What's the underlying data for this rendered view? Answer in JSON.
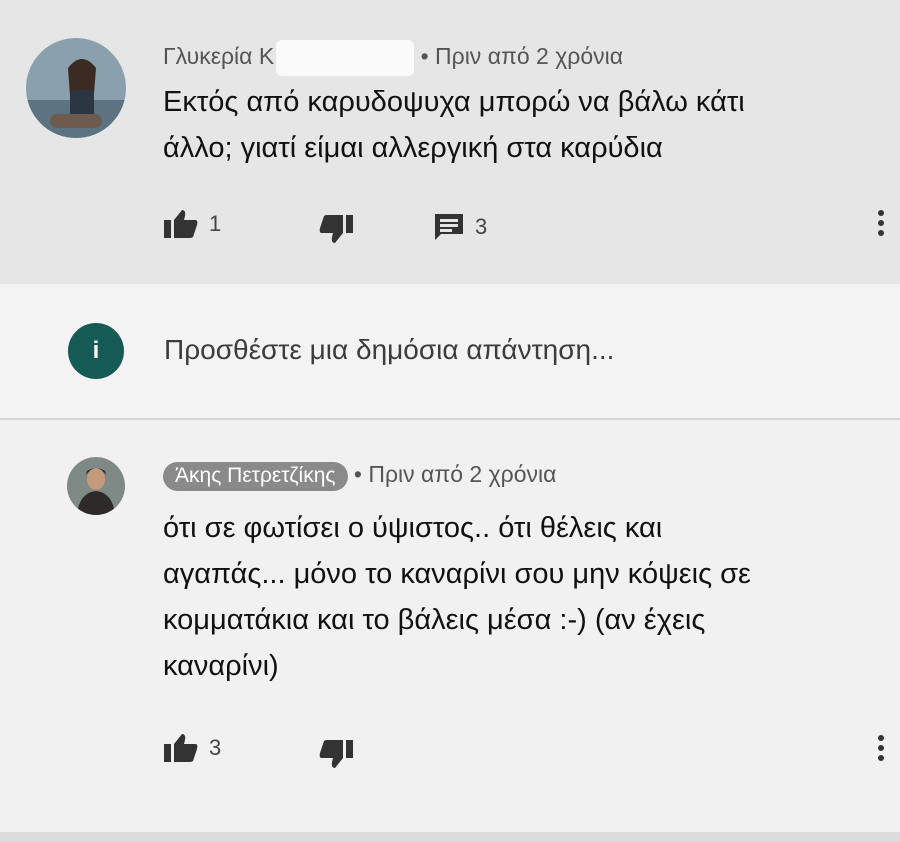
{
  "comments": [
    {
      "author": "Γλυκερία Κ",
      "time": "• Πριν από 2 χρόνια",
      "text_lines": [
        "Εκτός από καρυδοψυχα μπορώ να βάλω κάτι",
        "άλλο; γιατί είμαι αλλεργική στα καρύδια"
      ],
      "likes": "1",
      "replies": "3"
    },
    {
      "author": "Άκης Πετρετζίκης",
      "time": "• Πριν από 2 χρόνια",
      "text_lines": [
        "ότι σε φωτίσει ο ύψιστος.. ότι θέλεις και",
        "αγαπάς... μόνο το καναρίνι σου μην κόψεις σε",
        "κομματάκια και το βάλεις μέσα :-) (αν έχεις",
        "καναρίνι)"
      ],
      "likes": "3"
    }
  ],
  "reply_box": {
    "avatar_letter": "i",
    "placeholder": "Προσθέστε μια δημόσια απάντηση..."
  },
  "icons": {
    "like": "thumb-up-icon",
    "dislike": "thumb-down-icon",
    "reply": "comment-icon",
    "menu": "more-vert-icon"
  },
  "colors": {
    "reply_avatar": "#155a55",
    "author_badge": "#8a8a8a"
  }
}
